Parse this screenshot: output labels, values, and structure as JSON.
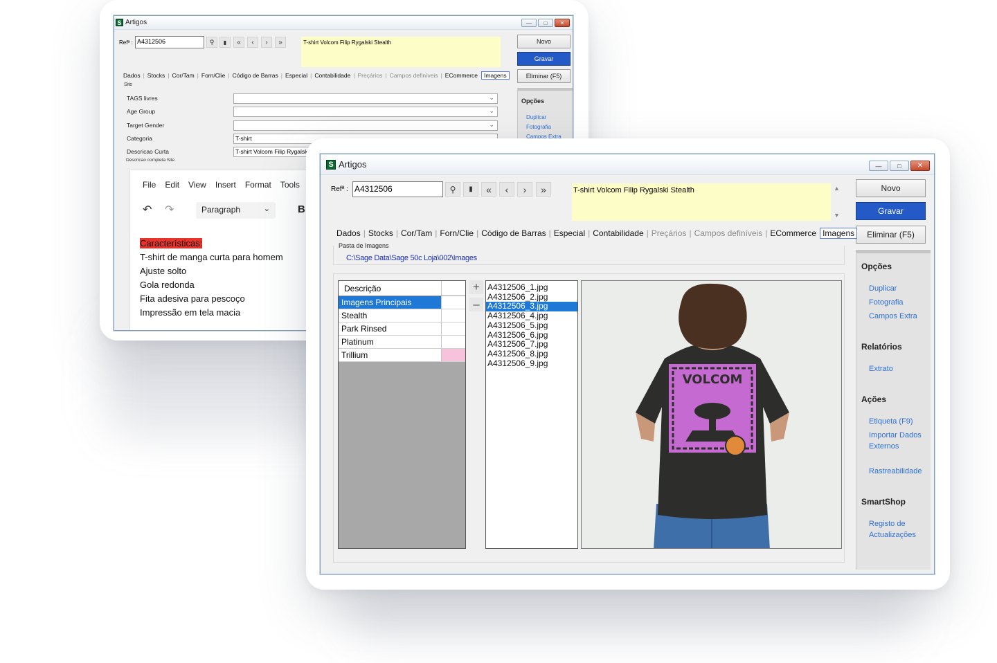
{
  "back_window": {
    "title": "Artigos",
    "ref_label": "Refª :",
    "ref_value": "A4312506",
    "description": "T-shirt Volcom Filip Rygalski Stealth",
    "buttons": {
      "novo": "Novo",
      "gravar": "Gravar",
      "eliminar": "Eliminar (F5)"
    },
    "tabs": [
      "Dados",
      "Stocks",
      "Cor/Tam",
      "Forn/Clie",
      "Código de Barras",
      "Especial",
      "Contabilidade",
      "Preçários",
      "Campos definíveis",
      "ECommerce",
      "Imagens"
    ],
    "site_label": "Site",
    "fields": [
      {
        "label": "TAGS livres",
        "value": ""
      },
      {
        "label": "Age Group",
        "value": ""
      },
      {
        "label": "Target Gender",
        "value": ""
      },
      {
        "label": "Categoria",
        "value": "T-shirt"
      },
      {
        "label": "Descricao Curta",
        "value": "T-shirt Volcom Filip Rygalsk"
      }
    ],
    "desc_completa_label": "Descricao completa Site",
    "editor_menu": [
      "File",
      "Edit",
      "View",
      "Insert",
      "Format",
      "Tools"
    ],
    "editor_block_format": "Paragraph",
    "editor_bold": "B",
    "editor_lines": [
      "Características:",
      "T-shirt de manga curta para homem",
      "Ajuste solto",
      "Gola redonda",
      "Fita adesiva para pescoço",
      "Impressão em tela macia"
    ],
    "side_heading": "Opções",
    "side_links": [
      "Duplicar",
      "Fotografia",
      "Campos Extra"
    ]
  },
  "front_window": {
    "title": "Artigos",
    "ref_label": "Refª :",
    "ref_value": "A4312506",
    "description": "T-shirt Volcom Filip Rygalski Stealth",
    "buttons": {
      "novo": "Novo",
      "gravar": "Gravar",
      "eliminar": "Eliminar (F5)"
    },
    "tabs": [
      "Dados",
      "Stocks",
      "Cor/Tam",
      "Forn/Clie",
      "Código de Barras",
      "Especial",
      "Contabilidade",
      "Preçários",
      "Campos definíveis",
      "ECommerce",
      "Imagens"
    ],
    "pasta_label": "Pasta de Imagens",
    "pasta_path": "C:\\Sage Data\\Sage 50c Loja\\002\\Images",
    "grid_header": "Descrição",
    "grid_rows": [
      "Imagens Principais",
      "Stealth",
      "Park Rinsed",
      "Platinum",
      "Trillium"
    ],
    "trillium_color": "#f7c2dc",
    "files": [
      "A4312506_1.jpg",
      "A4312506_2.jpg",
      "A4312506_3.jpg",
      "A4312506_4.jpg",
      "A4312506_5.jpg",
      "A4312506_6.jpg",
      "A4312506_7.jpg",
      "A4312506_8.jpg",
      "A4312506_9.jpg"
    ],
    "selected_file_index": 2,
    "tshirt_print": {
      "brand": "VOLCOM"
    },
    "sidebar": [
      {
        "heading": "Opções",
        "links": [
          "Duplicar",
          "Fotografia",
          "Campos Extra"
        ]
      },
      {
        "heading": "Relatórios",
        "links": [
          "Extrato"
        ]
      },
      {
        "heading": "Ações",
        "links": [
          "Etiqueta (F9)",
          "Importar Dados Externos",
          "Rastreabilidade"
        ]
      },
      {
        "heading": "SmartShop",
        "links": [
          "Registo de Actualizações"
        ]
      }
    ]
  },
  "colors": {
    "accent": "#2459c8",
    "selection": "#1e78d6",
    "description_bg": "#fdfdc8",
    "link": "#2f6fd4",
    "highlight_red": "#e8322a"
  }
}
